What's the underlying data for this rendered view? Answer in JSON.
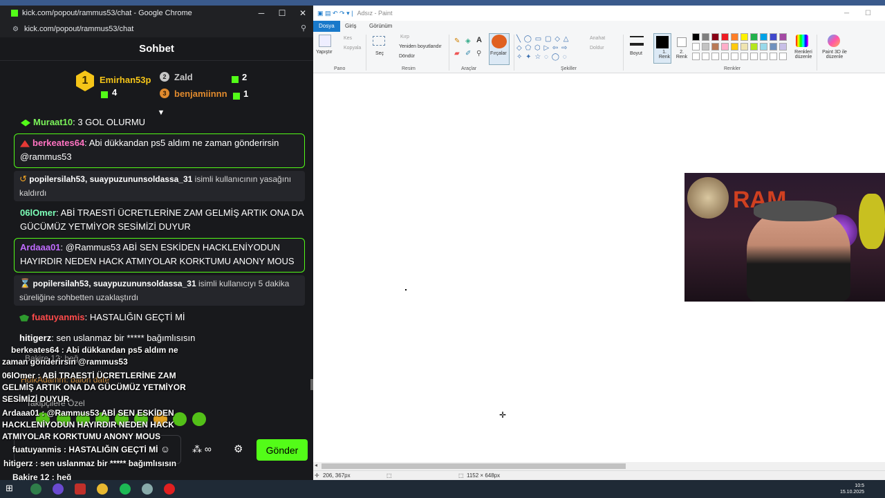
{
  "chrome": {
    "title": "kick.com/popout/rammus53/chat - Google Chrome",
    "url": "kick.com/popout/rammus53/chat",
    "minimize": "─",
    "maximize": "☐",
    "close": "✕"
  },
  "chat": {
    "header": "Sohbet",
    "leaderboard": {
      "first": {
        "rank": "1",
        "name": "Emirhan53p",
        "count": "4"
      },
      "second": {
        "rank": "2",
        "name": "Zald",
        "count": "2"
      },
      "third": {
        "rank": "3",
        "name": "benjamiinnn",
        "count": "1"
      }
    },
    "messages": [
      {
        "user": "Muraat10",
        "sep": ": ",
        "text": "3 GOL OLURMU"
      },
      {
        "user": "berkeates64",
        "sep": ": ",
        "text": "Abi dükkandan ps5 aldım ne zaman gönderirsin @rammus53"
      },
      {
        "users": "popilersilah53, suaypuzununsoldassa_31",
        "text": " isimli kullanıcının yasağını kaldırdı"
      },
      {
        "user": "06lOmer",
        "sep": ": ",
        "text": "ABİ TRAESTİ ÜCRETLERİNE ZAM GELMİŞ ARTIK ONA DA GÜCÜMÜZ YETMİYOR SESİMİZİ DUYUR"
      },
      {
        "user": "Ardaaa01",
        "sep": ": ",
        "text": "@Rammus53 ABİ SEN ESKİDEN HACKLENİYODUN HAYIRDIR NEDEN HACK ATMIYOLAR KORKTUMU ANONY MOUS"
      },
      {
        "users": "popilersilah53, suaypuzununsoldassa_31",
        "text": " isimli kullanıcıyı 5 dakika süreliğine sohbetten uzaklaştırdı"
      },
      {
        "user": "fuatuyanmis",
        "sep": ": ",
        "text": "HASTALIĞIN GEÇTİ Mİ"
      },
      {
        "user": "hitigerz",
        "sep": ": ",
        "text": "sen uslanmaz bir ***** bağımlısısın"
      }
    ],
    "hidden_behind": {
      "line1": "Bakire 12: heğ",
      "line2": "HulkAdamm: balon date",
      "followers_only": "Takipçilere Özel"
    },
    "send_label": "Gönder"
  },
  "overlay": {
    "l1": "berkeates64 : Abi dükkandan ps5 aldım ne",
    "l2": "zaman gönderirsin @rammus53",
    "l3": "06lOmer : ABİ TRAESTİ ÜCRETLERİNE ZAM",
    "l4": "GELMİŞ ARTIK ONA DA GÜCÜMÜZ YETMİYOR",
    "l5": "SESİMİZİ DUYUR",
    "l6": "Ardaaa01 : @Rammus53 ABİ SEN ESKİDEN",
    "l7": "HACKLENİYODUN HAYIRDIR NEDEN HACK",
    "l8": "ATMIYOLAR KORKTUMU ANONY MOUS",
    "l9": "fuatuyanmis : HASTALIĞIN GEÇTİ Mİ",
    "l10": "hitigerz : sen uslanmaz bir ***** bağımlısısın",
    "l11": "Bakire 12 : heğ"
  },
  "paint": {
    "title": "Adsız - Paint",
    "tabs": {
      "file": "Dosya",
      "home": "Giriş",
      "view": "Görünüm"
    },
    "clipboard": {
      "paste": "Yapıştır",
      "cut": "Kes",
      "copy": "Kopyala",
      "label": "Pano"
    },
    "image": {
      "select": "Seç",
      "crop": "Kırp",
      "resize": "Yeniden boyutlandır",
      "rotate": "Döndür",
      "label": "Resim"
    },
    "tools": {
      "brushes": "Fırçalar",
      "label": "Araçlar"
    },
    "shapes": {
      "outline": "Anahat",
      "fill": "Doldur",
      "label": "Şekiller"
    },
    "size": "Boyut",
    "color1": "1. Renk",
    "color2": "2. Renk",
    "colors_label": "Renkler",
    "edit_colors": "Renkleri düzenle",
    "paint3d": "Paint 3D ile düzenle",
    "status": {
      "cursor": "206, 367px",
      "canvas_size": "1152 × 648px"
    }
  },
  "taskbar": {
    "time": "10:5",
    "date": "15.10.2025"
  },
  "colors": {
    "kick_green": "#53fc18",
    "chat_bg": "#18191c",
    "muraat": "#7bf35a",
    "berke": "#ff73c2",
    "omer": "#7dffb8",
    "arda": "#c06bff",
    "fuat": "#ff4b4b",
    "hitigerz": "#ffffff",
    "gold": "#f5c518",
    "bronze": "#e08a2e"
  }
}
